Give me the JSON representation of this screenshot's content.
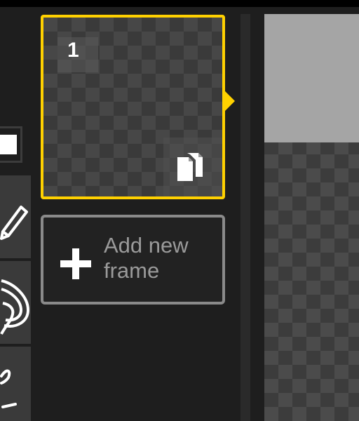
{
  "frames": [
    {
      "number": "1",
      "selected": true
    }
  ],
  "add_frame": {
    "label": "Add new frame"
  },
  "colors": {
    "accent": "#ffd100",
    "panel": "#1e1e1e",
    "tool_bg": "#3a3a3a",
    "primary_color": "#ffffff"
  },
  "icons": {
    "duplicate": "copy-icon",
    "add": "plus-icon",
    "tools": [
      "pen-icon",
      "lasso-icon",
      "stroke-icon"
    ]
  }
}
